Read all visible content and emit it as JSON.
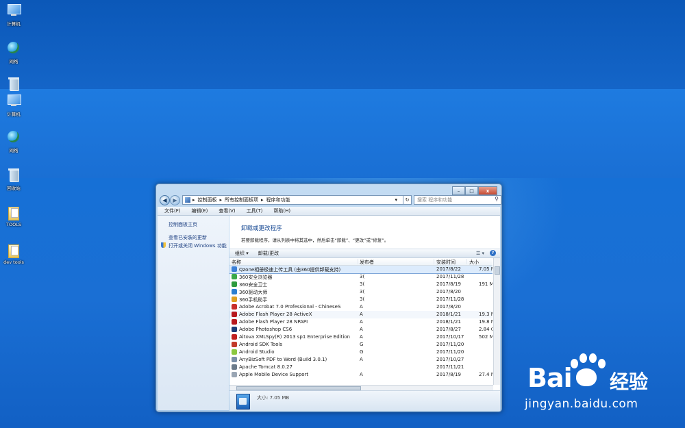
{
  "desktop": {
    "icons": [
      {
        "label": "计算机"
      },
      {
        "label": "网络"
      },
      {
        "label": "计算机"
      },
      {
        "label": "网络"
      },
      {
        "label": "回收站"
      },
      {
        "label": "TOOLS"
      },
      {
        "label": "dev tools"
      }
    ]
  },
  "window": {
    "controls": {
      "minimize": "–",
      "maximize": "□",
      "close": "x"
    },
    "breadcrumb": [
      "控制面板",
      "所有控制面板项",
      "程序和功能"
    ],
    "search_placeholder": "搜索 程序和功能",
    "menu": [
      "文件(F)",
      "编辑(E)",
      "查看(V)",
      "工具(T)",
      "帮助(H)"
    ],
    "sidebar": {
      "home": "控制面板主页",
      "updates": "查看已安装的更新",
      "features": "打开或关闭 Windows 功能"
    },
    "heading": "卸载或更改程序",
    "description": "若要卸载程序，请从列表中将其选中，然后单击“卸载”、“更改”或“修复”。",
    "commands": {
      "organize": "组织 ▾",
      "uninstall": "卸载/更改",
      "help": "?"
    },
    "columns": {
      "name": "名称",
      "publisher": "发布者",
      "date": "安装时间",
      "size": "大小"
    },
    "programs": [
      {
        "name": "Qzone相册极速上传工具 (由360提供卸载支持)",
        "publisher": "",
        "date": "2017/8/22",
        "size": "7.05 M",
        "color": "#3b7fd6"
      },
      {
        "name": "360安全浏览器",
        "publisher": "3(",
        "date": "2017/11/28",
        "size": "",
        "color": "#3aa84a"
      },
      {
        "name": "360安全卫士",
        "publisher": "3(",
        "date": "2017/8/19",
        "size": "191 M",
        "color": "#2f9b3d"
      },
      {
        "name": "360驱动大师",
        "publisher": "3(",
        "date": "2017/8/20",
        "size": "",
        "color": "#2c7fd0"
      },
      {
        "name": "360手机助手",
        "publisher": "3(",
        "date": "2017/11/28",
        "size": "",
        "color": "#e0a020"
      },
      {
        "name": "Adobe Acrobat 7.0 Professional - ChineseS",
        "publisher": "A",
        "date": "2017/8/20",
        "size": "",
        "color": "#c8302a"
      },
      {
        "name": "Adobe Flash Player 28 ActiveX",
        "publisher": "A",
        "date": "2018/1/21",
        "size": "19.3 M",
        "color": "#b8191e"
      },
      {
        "name": "Adobe Flash Player 28 NPAPI",
        "publisher": "A",
        "date": "2018/1/21",
        "size": "19.8 M",
        "color": "#b8191e"
      },
      {
        "name": "Adobe Photoshop CS6",
        "publisher": "A",
        "date": "2017/8/27",
        "size": "2.84 C",
        "color": "#1c3d78"
      },
      {
        "name": "Altova XMLSpy(R) 2013 sp1 Enterprise Edition",
        "publisher": "A",
        "date": "2017/10/17",
        "size": "502 M",
        "color": "#c02020"
      },
      {
        "name": "Android SDK Tools",
        "publisher": "G",
        "date": "2017/11/20",
        "size": "",
        "color": "#c23a2a"
      },
      {
        "name": "Android Studio",
        "publisher": "G",
        "date": "2017/11/20",
        "size": "",
        "color": "#8cc840"
      },
      {
        "name": "AnyBizSoft PDF to Word (Build 3.0.1)",
        "publisher": "A",
        "date": "2017/10/27",
        "size": "",
        "color": "#7a8fa8"
      },
      {
        "name": "Apache Tomcat 8.0.27",
        "publisher": "",
        "date": "2017/11/21",
        "size": "",
        "color": "#6b7a8a"
      },
      {
        "name": "Apple Mobile Device Support",
        "publisher": "A",
        "date": "2017/8/19",
        "size": "27.4 M",
        "color": "#9aa6b4"
      }
    ],
    "details": {
      "size_label": "大小: 7.05 MB"
    }
  },
  "watermark": {
    "brand": "Bai",
    "brand_cn": "经验",
    "url": "jingyan.baidu.com"
  }
}
